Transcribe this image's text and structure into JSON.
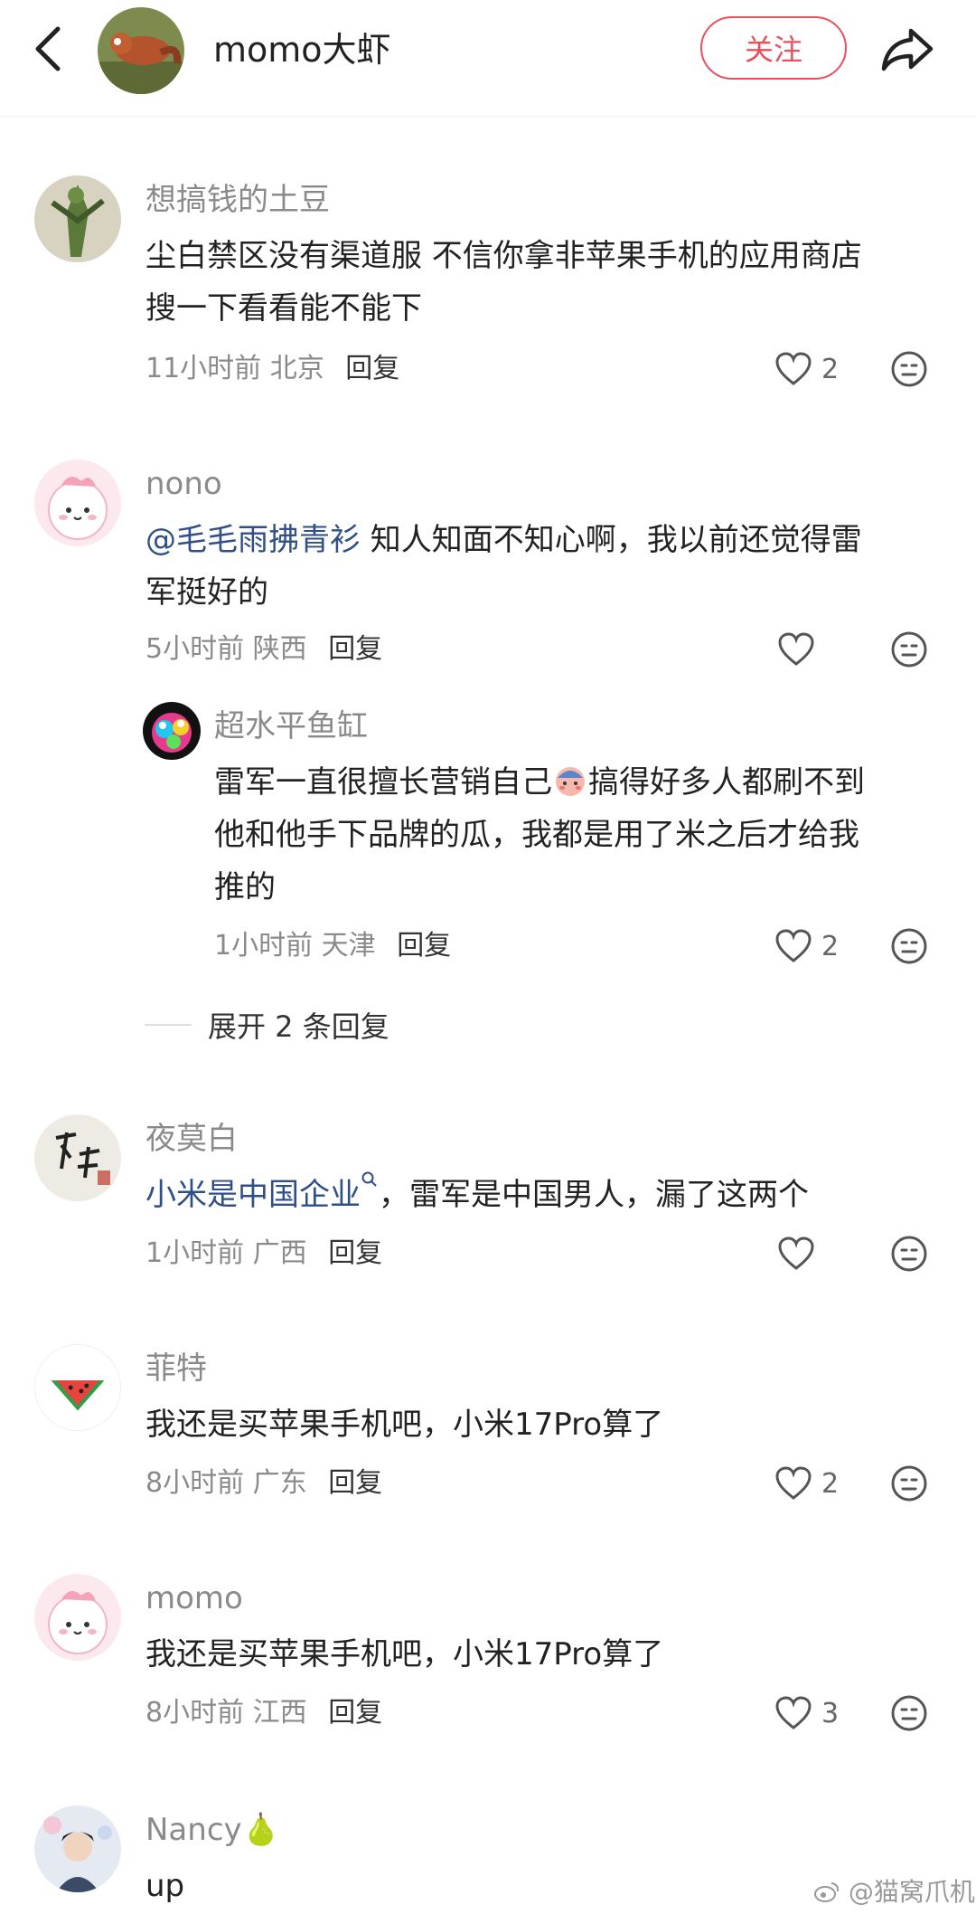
{
  "header": {
    "title": "momo大虾",
    "follow_label": "关注",
    "icons": [
      "back-arrow-icon",
      "share-icon"
    ]
  },
  "comments": [
    {
      "user": "想搞钱的土豆",
      "line1": "尘白禁区没有渠道服 不信你拿非苹果手机的应用商店",
      "line2": "搜一下看看能不能下",
      "time": "11小时前",
      "location": "北京",
      "reply_label": "回复",
      "likes": "2"
    },
    {
      "user": "nono",
      "mention": "@毛毛雨拂青衫",
      "line1_rest": " 知人知面不知心啊，我以前还觉得雷",
      "line2": "军挺好的",
      "time": "5小时前",
      "location": "陕西",
      "reply_label": "回复",
      "likes": ""
    },
    {
      "user": "超水平鱼缸",
      "line1_a": "雷军一直很擅长营销自己",
      "line1_b": "搞得好多人都刷不到",
      "line2": "他和他手下品牌的瓜，我都是用了米之后才给我",
      "line3": "推的",
      "time": "1小时前",
      "location": "天津",
      "reply_label": "回复",
      "likes": "2"
    },
    {
      "user": "夜莫白",
      "mention": "小米是中国企业",
      "line1_rest": "，雷军是中国男人，漏了这两个",
      "time": "1小时前",
      "location": "广西",
      "reply_label": "回复",
      "likes": ""
    },
    {
      "user": "菲特",
      "line1": "我还是买苹果手机吧，小米17Pro算了",
      "time": "8小时前",
      "location": "广东",
      "reply_label": "回复",
      "likes": "2"
    },
    {
      "user": "momo",
      "line1": "我还是买苹果手机吧，小米17Pro算了",
      "time": "8小时前",
      "location": "江西",
      "reply_label": "回复",
      "likes": "3"
    },
    {
      "user": "Nancy",
      "user_suffix": "🍐",
      "line1": "up"
    }
  ],
  "expand_label": "展开 2 条回复",
  "watermark": "@猫窝爪机",
  "colors": {
    "accent": "#e8505b",
    "mention": "#2f4f86",
    "muted": "#8a8a8a"
  }
}
